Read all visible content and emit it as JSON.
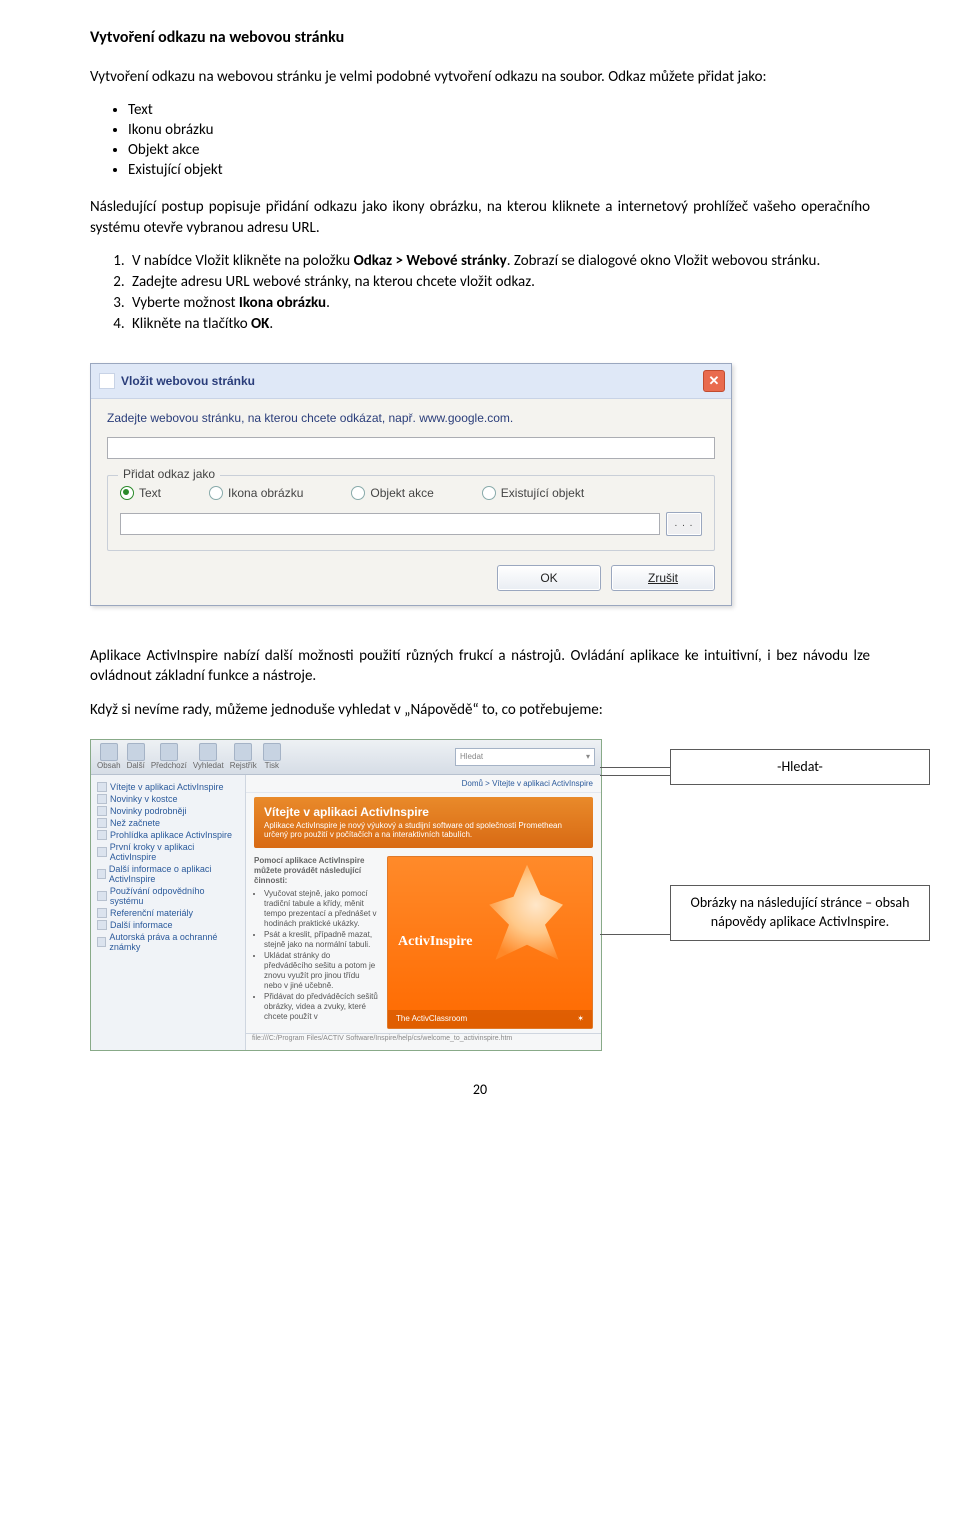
{
  "heading": "Vytvoření odkazu na webovou stránku",
  "intro": "Vytvoření odkazu na webovou stránku je velmi podobné vytvoření odkazu na soubor. Odkaz můžete přidat jako:",
  "bullets": [
    "Text",
    "Ikonu obrázku",
    "Objekt akce",
    "Existující objekt"
  ],
  "para2": "Následující postup popisuje přidání odkazu jako ikony obrázku, na kterou kliknete a internetový prohlížeč vašeho operačního systému otevře vybranou adresu URL.",
  "steps": [
    {
      "pre": "V nabídce Vložit klikněte na položku ",
      "bold": "Odkaz > Webové stránky",
      "post": ". Zobrazí se dialogové okno Vložit webovou stránku."
    },
    {
      "pre": "Zadejte adresu URL webové stránky, na kterou chcete vložit odkaz.",
      "bold": "",
      "post": ""
    },
    {
      "pre": "Vyberte možnost ",
      "bold": "Ikona obrázku",
      "post": "."
    },
    {
      "pre": "Klikněte na tlačítko ",
      "bold": "OK",
      "post": "."
    }
  ],
  "dialog": {
    "title": "Vložit webovou stránku",
    "desc": "Zadejte webovou stránku, na kterou chcete odkázat, např. www.google.com.",
    "legend": "Přidat odkaz jako",
    "radios": [
      "Text",
      "Ikona obrázku",
      "Objekt akce",
      "Existující objekt"
    ],
    "browse": ". . .",
    "ok": "OK",
    "cancel": "Zrušit"
  },
  "para3": "Aplikace ActivInspire nabízí další možnosti použití různých frukcí a nástrojů. Ovládání aplikace ke intuitivní, i bez návodu lze ovládnout základní funkce a nástroje.",
  "para4": "Když si nevíme rady, můžeme jednoduše vyhledat v „Nápovědě“ to, co potřebujeme:",
  "callout1": "-Hledat-",
  "callout2": "Obrázky na následující stránce – obsah nápovědy aplikace ActivInspire.",
  "app": {
    "toolbar": [
      "Obsah",
      "Další",
      "Předchozí",
      "Vyhledat",
      "Rejstřík",
      "Tisk"
    ],
    "search": "Hledat",
    "sidebar": [
      "Vítejte v aplikaci ActivInspire",
      "Novinky v kostce",
      "Novinky podrobněji",
      "Než začnete",
      "Prohlídka aplikace ActivInspire",
      "První kroky v aplikaci ActivInspire",
      "Další informace o aplikaci ActivInspire",
      "Používání odpovědního systému",
      "Referenční materiály",
      "Další informace",
      "Autorská práva a ochranné známky"
    ],
    "crumb": "Domů > Vítejte v aplikaci ActivInspire",
    "heroTitle": "Vítejte v aplikaci ActivInspire",
    "heroSub": "Aplikace ActivInspire je nový výukový a studijní software od společnosti Promethean určený pro použití v počítačích a na interaktivních tabulích.",
    "leftHead": "Pomocí aplikace ActivInspire můžete provádět následující činnosti:",
    "leftItems": [
      "Vyučovat stejně, jako pomocí tradiční tabule a křídy, měnit tempo prezentací a přednášet v hodinách praktické ukázky.",
      "Psát a kreslit, případně mazat, stejně jako na normální tabuli.",
      "Ukládat stránky do předváděcího sešitu a potom je znovu využít pro jinou třídu nebo v jiné učebně.",
      "Přidávat do předváděcích sešitů obrázky, videa a zvuky, které chcete použít v"
    ],
    "brand": "ActivInspire",
    "footer": "The ActivClassroom",
    "status": "file:///C:/Program Files/ACTIV Software/Inspire/help/cs/welcome_to_activinspire.htm"
  },
  "pageNumber": "20"
}
